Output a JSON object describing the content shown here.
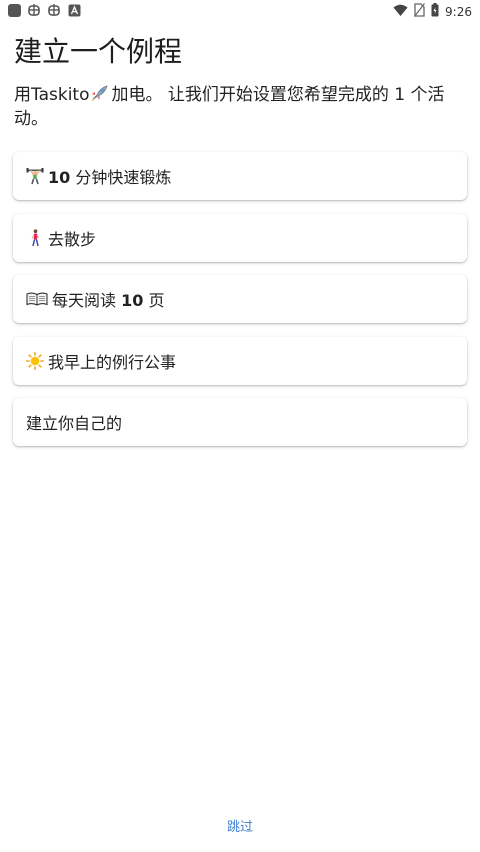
{
  "status_bar": {
    "time": "9:26",
    "icons": [
      "square-icon",
      "bug-icon",
      "bug-icon",
      "a-icon",
      "wifi-icon",
      "no-sim-icon",
      "battery-icon"
    ]
  },
  "title": "建立一个例程",
  "subtitle": {
    "prefix": "用Taskito",
    "suffix": "加电。 让我们开始设置您希望完成的 1 个活动。",
    "icon": "rocket-icon"
  },
  "options": [
    {
      "icon": "weightlifter-icon",
      "num": "10",
      "label": " 分钟快速锻炼"
    },
    {
      "icon": "walking-person-icon",
      "num": "",
      "label": "去散步"
    },
    {
      "icon": "open-book-icon",
      "num": "",
      "label": "每天阅读 ",
      "num_after": "10",
      "label_after": " 页"
    },
    {
      "icon": "sun-icon",
      "num": "",
      "label": "我早上的例行公事"
    },
    {
      "icon": "",
      "num": "",
      "label": "建立你自己的"
    }
  ],
  "skip_label": "跳过",
  "colors": {
    "accent": "#3f7fd0",
    "text": "#222222",
    "background": "#ffffff"
  }
}
